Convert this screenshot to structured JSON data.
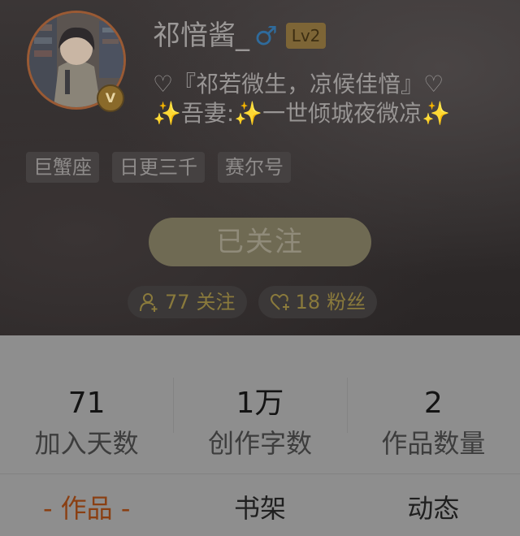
{
  "profile": {
    "username": "祁愔酱_",
    "gender_symbol": "♂",
    "level": "Lv2",
    "vip_badge": "V",
    "bio_line1": "♡『祁若微生，凉候佳愔』♡",
    "bio_line2": "✨吾妻:✨一世倾城夜微凉✨",
    "tags": [
      "巨蟹座",
      "日更三千",
      "赛尔号"
    ],
    "follow_button": "已关注",
    "following_count": "77",
    "following_label": "关注",
    "fans_count": "18",
    "fans_label": "粉丝"
  },
  "stats": [
    {
      "value": "71",
      "label": "加入天数"
    },
    {
      "value": "1万",
      "label": "创作字数"
    },
    {
      "value": "2",
      "label": "作品数量"
    }
  ],
  "tabs": [
    {
      "label": "- 作品 -",
      "active": true
    },
    {
      "label": "书架",
      "active": false
    },
    {
      "label": "动态",
      "active": false
    }
  ],
  "colors": {
    "accent": "#8a3f12",
    "gold": "#8a7a3c",
    "gender_blue": "#2f6b9c"
  },
  "icons": {
    "following": "person-add-icon",
    "fans": "heart-add-icon",
    "gender": "male-icon",
    "vip": "vip-badge-icon"
  }
}
